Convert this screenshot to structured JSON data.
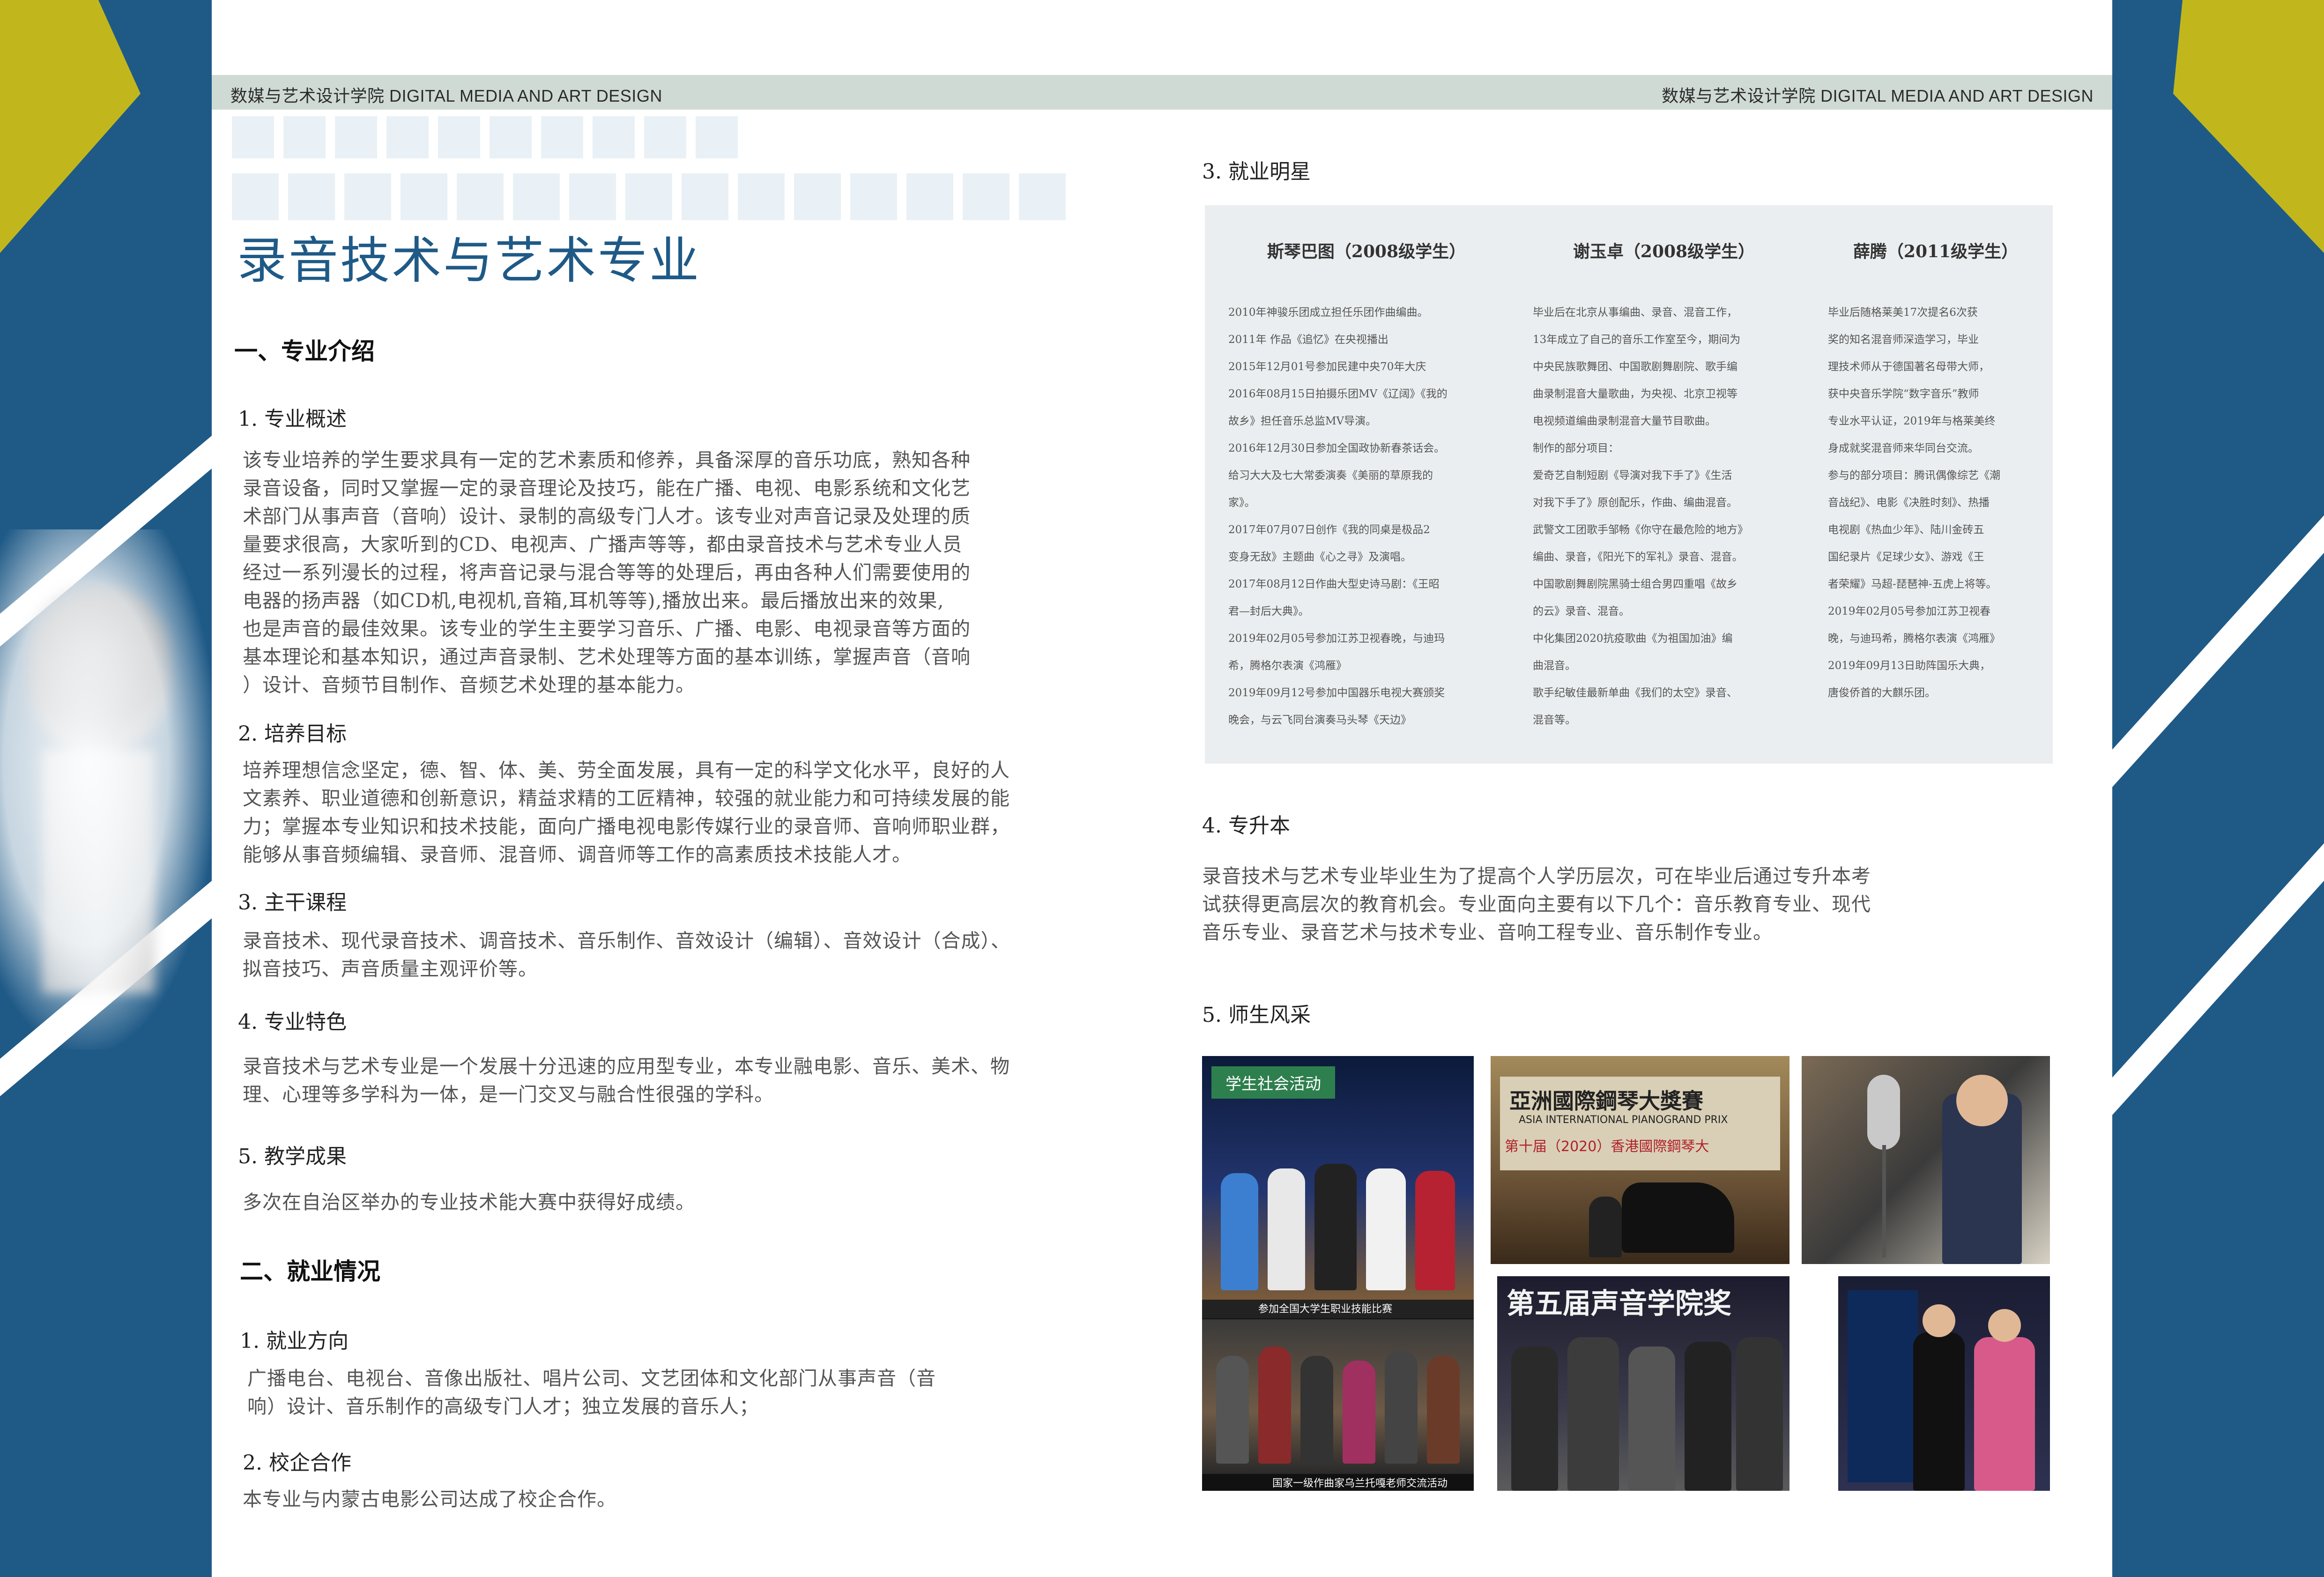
{
  "header": {
    "left": "数媒与艺术设计学院 DIGITAL MEDIA AND ART DESIGN",
    "right": "数媒与艺术设计学院 DIGITAL MEDIA AND ART DESIGN"
  },
  "colors": {
    "band": "#1f5a87",
    "accent": "#c1b71d",
    "header_bar": "#cfdad5",
    "title": "#1f5a87",
    "stars_bg": "#ebeef0"
  },
  "title": "录音技术与艺术专业",
  "sec1": {
    "heading": "一、专业介绍",
    "s1": {
      "heading": "1. 专业概述",
      "lines": [
        "该专业培养的学生要求具有一定的艺术素质和修养，具备深厚的音乐功底，熟知各种",
        "录音设备，同时又掌握一定的录音理论及技巧，能在广播、电视、电影系统和文化艺",
        "术部门从事声音（音响）设计、录制的高级专门人才。该专业对声音记录及处理的质",
        "量要求很高，大家听到的CD、电视声、广播声等等，都由录音技术与艺术专业人员",
        "经过一系列漫长的过程，将声音记录与混合等等的处理后，再由各种人们需要使用的",
        "电器的扬声器（如CD机,电视机,音箱,耳机等等),播放出来。最后播放出来的效果,",
        "也是声音的最佳效果。该专业的学生主要学习音乐、广播、电影、电视录音等方面的",
        "基本理论和基本知识，通过声音录制、艺术处理等方面的基本训练，掌握声音（音响",
        "）设计、音频节目制作、音频艺术处理的基本能力。"
      ]
    },
    "s2": {
      "heading": "2. 培养目标",
      "lines": [
        "培养理想信念坚定，德、智、体、美、劳全面发展，具有一定的科学文化水平，良好的人",
        "文素养、职业道德和创新意识，精益求精的工匠精神，较强的就业能力和可持续发展的能",
        "力；掌握本专业知识和技术技能，面向广播电视电影传媒行业的录音师、音响师职业群，",
        "能够从事音频编辑、录音师、混音师、调音师等工作的高素质技术技能人才。"
      ]
    },
    "s3": {
      "heading": "3. 主干课程",
      "lines": [
        "录音技术、现代录音技术、调音技术、音乐制作、音效设计（编辑）、音效设计（合成）、",
        "拟音技巧、声音质量主观评价等。"
      ]
    },
    "s4": {
      "heading": "4. 专业特色",
      "lines": [
        "录音技术与艺术专业是一个发展十分迅速的应用型专业，本专业融电影、音乐、美术、物",
        "理、心理等多学科为一体，是一门交叉与融合性很强的学科。"
      ]
    },
    "s5": {
      "heading": "5. 教学成果",
      "lines": [
        "多次在自治区举办的专业技术能大赛中获得好成绩。"
      ]
    }
  },
  "sec2": {
    "heading": "二、就业情况",
    "s1": {
      "heading": "1. 就业方向",
      "lines": [
        "广播电台、电视台、音像出版社、唱片公司、文艺团体和文化部门从事声音（音",
        "响）设计、音乐制作的高级专门人才；独立发展的音乐人；"
      ]
    },
    "s2": {
      "heading": "2. 校企合作",
      "lines": [
        "本专业与内蒙古电影公司达成了校企合作。"
      ]
    },
    "s3": {
      "heading": "3. 就业明星",
      "stars": [
        {
          "name": "斯琴巴图（2008级学生）",
          "lines": [
            "2010年神骏乐团成立担任乐团作曲编曲。",
            "2011年  作品《追忆》在央视播出",
            "2015年12月01号参加民建中央70年大庆",
            "2016年08月15日拍摄乐团MV《辽阔》《我的",
            "故乡》担任音乐总监MV导演。",
            " 2016年12月30日参加全国政协新春茶话会。",
            "给习大大及七大常委演奏《美丽的草原我的",
            "家》。",
            "2017年07月07日创作《我的同桌是极品2",
            "变身无敌》主题曲《心之寻》及演唱。",
            " 2017年08月12日作曲大型史诗马剧：《王昭",
            "君—封后大典》。",
            "2019年02月05号参加江苏卫视春晚，与迪玛",
            "希，腾格尔表演《鸿雁》",
            "2019年09月12号参加中国器乐电视大赛颁奖",
            "晚会，与云飞同台演奏马头琴《天边》"
          ]
        },
        {
          "name": "谢玉卓（2008级学生）",
          "lines": [
            "毕业后在北京从事编曲、录音、混音工作，",
            "13年成立了自己的音乐工作室至今，期间为",
            "中央民族歌舞团、中国歌剧舞剧院、歌手编",
            "曲录制混音大量歌曲，为央视、北京卫视等",
            "电视频道编曲录制混音大量节目歌曲。",
            "制作的部分项目：",
            "爱奇艺自制短剧《导演对我下手了》《生活",
            "对我下手了》原创配乐，作曲、编曲混音。",
            "武警文工团歌手邹畅《你守在最危险的地方》",
            "编曲、录音，《阳光下的军礼》录音、混音。",
            "中国歌剧舞剧院黑骑士组合男四重唱《故乡",
            "的云》录音、混音。",
            "中化集团2020抗疫歌曲《为祖国加油》编",
            "曲混音。",
            "歌手纪敏佳最新单曲《我们的太空》录音、",
            "混音等。"
          ]
        },
        {
          "name": "薛腾（2011级学生）",
          "lines": [
            "毕业后随格莱美17次提名6次获",
            "奖的知名混音师深造学习，毕业",
            "理技术师从于德国著名母带大师，",
            "获中央音乐学院“数字音乐”教师",
            "专业水平认证，2019年与格莱美终",
            "身成就奖混音师来华同台交流。",
            "参与的部分项目：腾讯偶像综艺《潮",
            "音战纪》、电影《决胜时刻》、热播",
            "电视剧《热血少年》、陆川金砖五",
            "国纪录片《足球少女》、游戏《王",
            "者荣耀》马超-琵琶神-五虎上将等。",
            "2019年02月05号参加江苏卫视春",
            "晚，与迪玛希，腾格尔表演《鸿雁》",
            "2019年09月13日助阵国乐大典，",
            "唐俊侨首的大麒乐团。"
          ]
        }
      ]
    },
    "s4": {
      "heading": "4. 专升本",
      "lines": [
        "录音技术与艺术专业毕业生为了提高个人学历层次，可在毕业后通过专升本考",
        "试获得更高层次的教育机会。专业面向主要有以下几个：音乐教育专业、现代",
        "音乐专业、录音艺术与技术专业、音响工程专业、音乐制作专业。"
      ]
    },
    "s5": {
      "heading": "5. 师生风采",
      "photos": {
        "p1_tag": "学生社会活动",
        "p1_caption": "参加全国大学生职业技能比赛",
        "p2_line1": "亞洲國際鋼琴大獎賽",
        "p2_line2": "ASIA INTERNATIONAL PIANOGRAND PRIX",
        "p2_line3": "第十届（2020）香港國際鋼琴大",
        "p4_caption": "国家一级作曲家乌兰托嘎老师交流活动",
        "p5_banner": "第五届声音学院奖"
      }
    }
  }
}
